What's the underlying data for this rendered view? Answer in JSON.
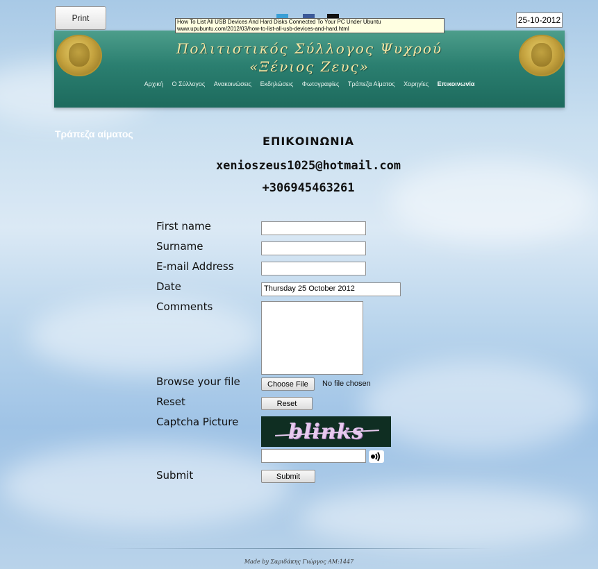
{
  "toolbar": {
    "print_label": "Print",
    "date": "25-10-2012"
  },
  "tooltip": {
    "line1": "How To List All USB Devices And Hard Disks Connected To Your PC Under Ubuntu",
    "line2": "www.upubuntu.com/2012/03/how-to-list-all-usb-devices-and-hard.html"
  },
  "header": {
    "title_line1": "Πολιτιστικός Σύλλογος Ψυχρού",
    "title_line2": "«Ξένιος Ζευς»"
  },
  "nav": {
    "items": [
      "Αρχική",
      "Ο Σύλλογος",
      "Ανακοινώσεις",
      "Εκδηλώσεις",
      "Φωτογραφίες",
      "Τράπεζα Αίματος",
      "Χορηγίες",
      "Επικοινωνία"
    ]
  },
  "sidebar": {
    "link": "Τράπεζα αίματος"
  },
  "contact": {
    "title": "ΕΠΙΚΟΙΝΩΝΙΑ",
    "email": "xenioszeus1025@hotmail.com",
    "phone": "+306945463261"
  },
  "form": {
    "first_name_label": "First name",
    "surname_label": "Surname",
    "email_label": "E-mail Address",
    "date_label": "Date",
    "date_value": "Thursday 25 October 2012",
    "comments_label": "Comments",
    "file_label": "Browse your file",
    "choose_file_button": "Choose File",
    "no_file_text": "No file chosen",
    "reset_label": "Reset",
    "reset_button": "Reset",
    "captcha_label": "Captcha Picture",
    "captcha_text": "blinks",
    "submit_label": "Submit",
    "submit_button": "Submit"
  },
  "footer": {
    "text": "Made by Σαριδάκης Γιώργος ΑΜ:1447"
  },
  "colors": {
    "banner": "#2b7f70",
    "title_gold": "#f6e6a3",
    "captcha_bg": "#0f2e22"
  }
}
